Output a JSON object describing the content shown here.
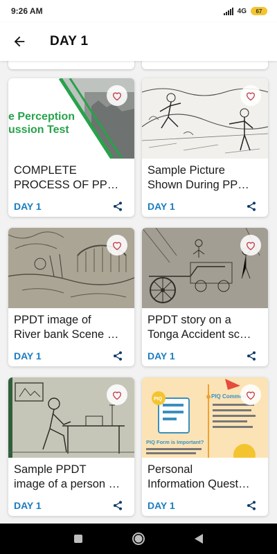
{
  "status_bar": {
    "time": "9:26 AM",
    "network": "4G",
    "battery": "67"
  },
  "app_bar": {
    "title": "DAY 1"
  },
  "cards": [
    {
      "title_line1": "COMPLETE",
      "title_line2": "PROCESS OF PP…",
      "day": "DAY 1",
      "thumb_text_1": "e Perception",
      "thumb_text_2": "ussion Test"
    },
    {
      "title_line1": "Sample Picture",
      "title_line2": "Shown During PP…",
      "day": "DAY 1"
    },
    {
      "title_line1": "PPDT image of",
      "title_line2": "River bank Scene …",
      "day": "DAY 1"
    },
    {
      "title_line1": "PPDT story on a",
      "title_line2": "Tonga Accident sc…",
      "day": "DAY 1"
    },
    {
      "title_line1": "Sample PPDT",
      "title_line2": "image of a person …",
      "day": "DAY 1"
    },
    {
      "title_line1": "Personal",
      "title_line2": "Information Quest…",
      "day": "DAY 1",
      "thumb_text_1": "PIQ Common",
      "thumb_text_2": "PIQ Form is Important?",
      "thumb_text_3": "PIQ"
    }
  ],
  "colors": {
    "accent": "#1a7cc1",
    "share": "#0d3b66",
    "heart": "#c23a4a",
    "green": "#27a24a"
  }
}
